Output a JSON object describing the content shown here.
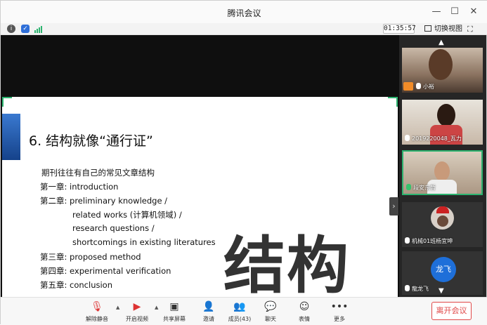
{
  "window": {
    "title": "腾讯会议"
  },
  "statusbar": {
    "timer": "01:35:57",
    "switch_view_label": "切换视图"
  },
  "slide": {
    "title": "6. 结构就像“通行证”",
    "intro": "期刊往往有自己的常见文章结构",
    "lines": [
      {
        "chapter": "第一章:",
        "text": "introduction"
      },
      {
        "chapter": "第二章:",
        "text": "preliminary knowledge /"
      },
      {
        "chapter": "",
        "text": "related works (计算机领域) /"
      },
      {
        "chapter": "",
        "text": "research questions /"
      },
      {
        "chapter": "",
        "text": "shortcomings in existing literatures"
      },
      {
        "chapter": "第三章:",
        "text": "proposed method"
      },
      {
        "chapter": "第四章:",
        "text": "experimental verification"
      },
      {
        "chapter": "第五章:",
        "text": "conclusion"
      }
    ],
    "big_word": "结构"
  },
  "participants": [
    {
      "name": "小裕"
    },
    {
      "name": "2019220048_瓦力"
    },
    {
      "name": "段安东哲"
    },
    {
      "name": "机械01班杨宜坤"
    },
    {
      "name": "龍龙飞",
      "avatar_text": "龙飞"
    }
  ],
  "toolbar": {
    "mute_label": "解除静音",
    "video_label": "开启视频",
    "share_label": "共享屏幕",
    "invite_label": "邀请",
    "members_label": "成员(43)",
    "chat_label": "聊天",
    "emoji_label": "表情",
    "more_label": "更多",
    "leave_label": "离开会议"
  },
  "colors": {
    "accent_green": "#2cb36f",
    "leave_red": "#e04848",
    "avatar_blue": "#1e6fd9"
  }
}
